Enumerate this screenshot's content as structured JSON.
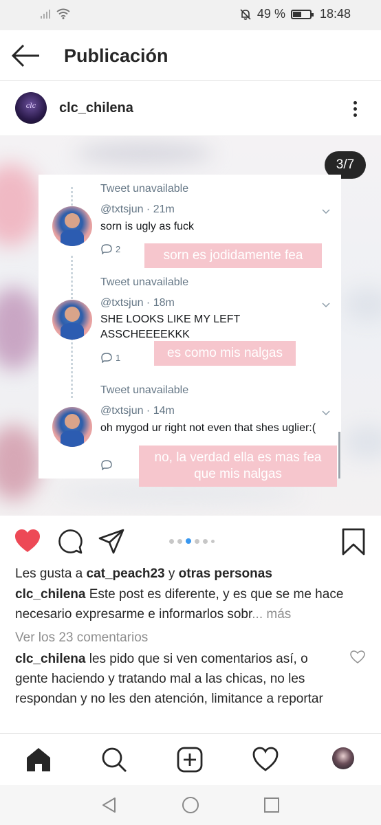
{
  "status_bar": {
    "battery_text": "49 %",
    "battery_level": 0.49,
    "time": "18:48",
    "icons": [
      "signal-icon",
      "wifi-icon",
      "mute-icon",
      "battery-icon"
    ]
  },
  "app_bar": {
    "title": "Publicación",
    "back_icon": "arrow-left-icon"
  },
  "post": {
    "username": "clc_chilena",
    "avatar_text": "clc",
    "more_icon": "more-vertical-icon",
    "counter": "3/7",
    "tweets": [
      {
        "unavailable": "Tweet unavailable",
        "meta": "@txtsjun · 21m",
        "text": "sorn is ugly as fuck",
        "replies": "2",
        "translation": "sorn es jodidamente fea"
      },
      {
        "unavailable": "Tweet unavailable",
        "meta": "@txtsjun · 18m",
        "text": "SHE LOOKS LIKE MY LEFT ASSCHEEEEKKK",
        "replies": "1",
        "translation": "es como mis nalgas"
      },
      {
        "unavailable": "Tweet unavailable",
        "meta": "@txtsjun · 14m",
        "text": "oh mygod ur right not even that shes uglier:(",
        "replies": "",
        "translation": "no, la verdad ella es mas fea que mis nalgas"
      }
    ],
    "carousel": {
      "count": 6,
      "active_index": 2
    },
    "likes": {
      "prefix": "Les gusta a ",
      "user": "cat_peach23",
      "joiner": " y ",
      "rest": "otras personas"
    },
    "caption": {
      "user": "clc_chilena",
      "text": " Este post es diferente, y es que se me hace necesario expresarme e informarlos sobr",
      "ellipsis": "... ",
      "more": "más"
    },
    "view_comments": "Ver los 23 comentarios",
    "comment": {
      "user": "clc_chilena",
      "text": " les pido que si ven comentarios así, o gente haciendo y tratando mal a las chicas, no les respondan y no les den atención, limitance a reportar"
    },
    "colors": {
      "like_red": "#ed4956",
      "carousel_active": "#3897f0",
      "translation_bg": "#f6c6cd",
      "counter_bg": "#262626"
    }
  },
  "bottom_nav": {
    "items": [
      "home-icon",
      "search-icon",
      "add-post-icon",
      "activity-heart-icon",
      "profile-avatar"
    ]
  },
  "system_nav": {
    "items": [
      "back-triangle-icon",
      "home-circle-icon",
      "recents-square-icon"
    ]
  }
}
